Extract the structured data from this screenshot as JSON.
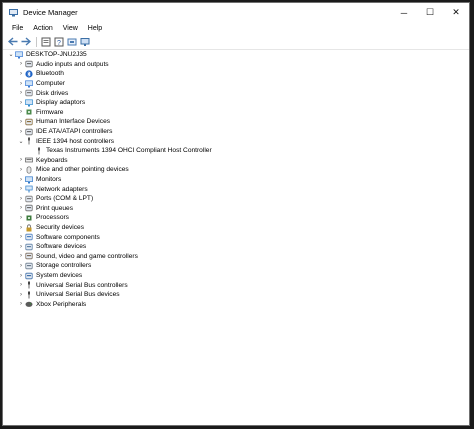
{
  "window": {
    "title": "Device Manager",
    "minimize": "─",
    "maximize": "☐",
    "close": "✕"
  },
  "menu": [
    "File",
    "Action",
    "View",
    "Help"
  ],
  "toolbar": [
    "back-icon",
    "forward-icon",
    "properties-icon",
    "help-icon",
    "scan-icon",
    "monitor-icon"
  ],
  "tree": {
    "root": "DESKTOP-JNU2J35",
    "items": [
      {
        "label": "Audio inputs and outputs",
        "icon": "speaker-icon",
        "expanded": false
      },
      {
        "label": "Bluetooth",
        "icon": "bluetooth-icon",
        "expanded": false
      },
      {
        "label": "Computer",
        "icon": "computer-icon",
        "expanded": false
      },
      {
        "label": "Disk drives",
        "icon": "disk-icon",
        "expanded": false
      },
      {
        "label": "Display adaptors",
        "icon": "display-icon",
        "expanded": false
      },
      {
        "label": "Firmware",
        "icon": "chip-icon",
        "expanded": false
      },
      {
        "label": "Human Interface Devices",
        "icon": "hid-icon",
        "expanded": false
      },
      {
        "label": "IDE ATA/ATAPI controllers",
        "icon": "controller-icon",
        "expanded": false
      },
      {
        "label": "IEEE 1394 host controllers",
        "icon": "firewire-icon",
        "expanded": true,
        "children": [
          {
            "label": "Texas Instruments 1394 OHCI Compliant Host Controller",
            "icon": "firewire-icon"
          }
        ]
      },
      {
        "label": "Keyboards",
        "icon": "keyboard-icon",
        "expanded": false
      },
      {
        "label": "Mice and other pointing devices",
        "icon": "mouse-icon",
        "expanded": false
      },
      {
        "label": "Monitors",
        "icon": "monitor-icon",
        "expanded": false
      },
      {
        "label": "Network adapters",
        "icon": "network-icon",
        "expanded": false
      },
      {
        "label": "Ports (COM & LPT)",
        "icon": "port-icon",
        "expanded": false
      },
      {
        "label": "Print queues",
        "icon": "printer-icon",
        "expanded": false
      },
      {
        "label": "Processors",
        "icon": "processor-icon",
        "expanded": false
      },
      {
        "label": "Security devices",
        "icon": "security-icon",
        "expanded": false
      },
      {
        "label": "Software components",
        "icon": "component-icon",
        "expanded": false
      },
      {
        "label": "Software devices",
        "icon": "software-icon",
        "expanded": false
      },
      {
        "label": "Sound, video and game controllers",
        "icon": "sound-icon",
        "expanded": false
      },
      {
        "label": "Storage controllers",
        "icon": "storage-icon",
        "expanded": false
      },
      {
        "label": "System devices",
        "icon": "system-icon",
        "expanded": false
      },
      {
        "label": "Universal Serial Bus controllers",
        "icon": "usb-icon",
        "expanded": false
      },
      {
        "label": "Universal Serial Bus devices",
        "icon": "usb-icon",
        "expanded": false
      },
      {
        "label": "Xbox Peripherals",
        "icon": "xbox-icon",
        "expanded": false
      }
    ]
  }
}
